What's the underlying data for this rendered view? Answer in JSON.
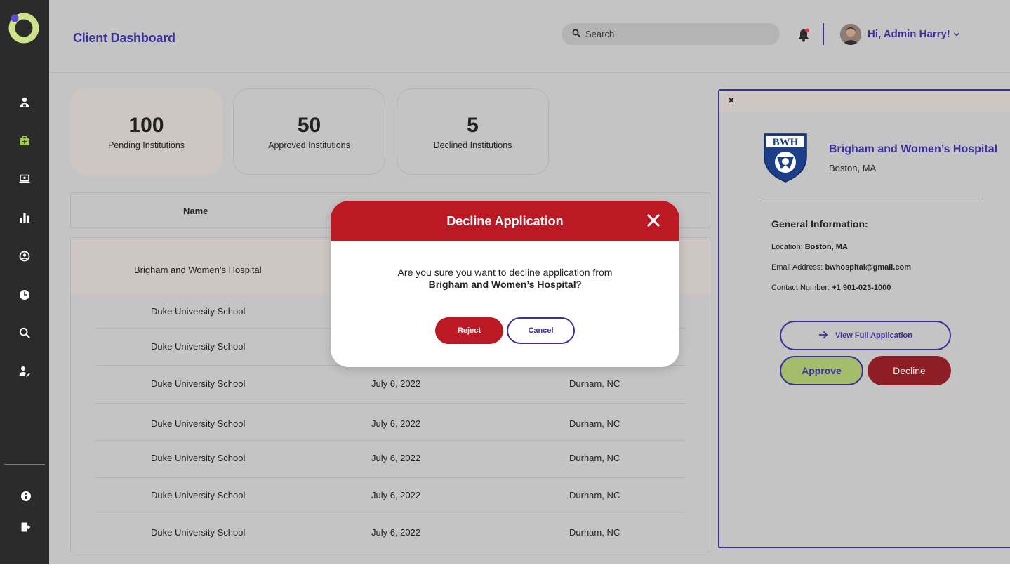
{
  "colors": {
    "accent": "#3b2f9e",
    "danger": "#bb1a25",
    "approve": "#a4bd6a",
    "sidebar": "#2b2b2b",
    "logo": "#cde38a"
  },
  "sidebar": {
    "icons": [
      "user-upload-icon",
      "briefcase-medical-icon",
      "monitor-icon",
      "bar-chart-icon",
      "user-circle-icon",
      "clock-icon",
      "search-icon",
      "user-edit-icon"
    ],
    "bottom_icons": [
      "info-icon",
      "logout-icon"
    ]
  },
  "header": {
    "title": "Client Dashboard",
    "search_placeholder": "Search",
    "greeting": "Hi, Admin Harry!"
  },
  "stats": [
    {
      "value": "100",
      "label": "Pending Institutions"
    },
    {
      "value": "50",
      "label": "Approved Institutions"
    },
    {
      "value": "5",
      "label": "Declined Institutions"
    }
  ],
  "table": {
    "columns": [
      "Name"
    ],
    "selected_row": {
      "name": "Brigham and Women’s Hospital"
    },
    "rows": [
      {
        "name": "Duke University School",
        "date": "",
        "location": ""
      },
      {
        "name": "Duke University School",
        "date": "",
        "location": ""
      },
      {
        "name": "Duke University School",
        "date": "July 6, 2022",
        "location": "Durham, NC"
      },
      {
        "name": "Duke University School",
        "date": "July 6, 2022",
        "location": "Durham, NC"
      },
      {
        "name": "Duke University School",
        "date": "July 6, 2022",
        "location": "Durham, NC"
      },
      {
        "name": "Duke University School",
        "date": "July 6, 2022",
        "location": "Durham, NC"
      },
      {
        "name": "Duke University School",
        "date": "July 6, 2022",
        "location": "Durham, NC"
      }
    ]
  },
  "panel": {
    "close": "×",
    "logo_text": "BWH",
    "hospital_name": "Brigham and Women’s Hospital",
    "hospital_location": "Boston, MA",
    "general_title": "General Information:",
    "location_label": "Location:",
    "location_value": "Boston, MA",
    "email_label": "Email Address:",
    "email_value": "bwhospital@gmail.com",
    "contact_label": "Contact Number:",
    "contact_value": "+1 901-023-1000",
    "view_full_label": "View Full Application",
    "approve_label": "Approve",
    "decline_label": "Decline"
  },
  "modal": {
    "title": "Decline Application",
    "message": "Are you sure you want to decline application from",
    "target": "Brigham and Women’s Hospital",
    "suffix": "?",
    "reject_label": "Reject",
    "cancel_label": "Cancel"
  }
}
